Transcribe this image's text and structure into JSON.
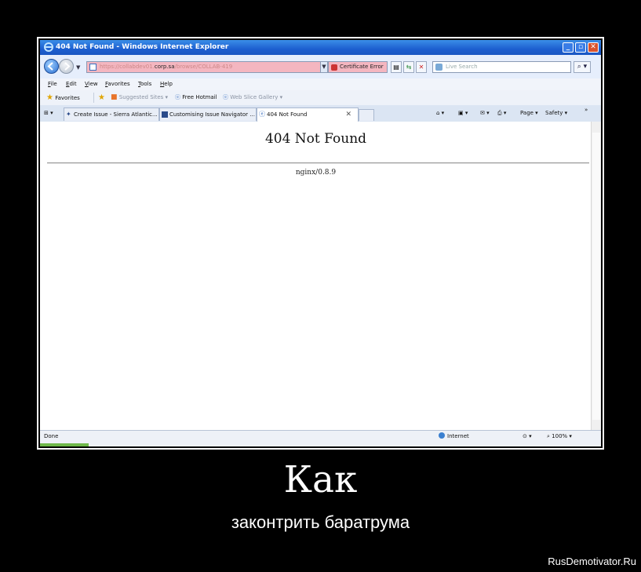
{
  "window": {
    "title": "404 Not Found - Windows Internet Explorer",
    "minimize": "_",
    "maximize": "▫",
    "close": "✕"
  },
  "address": {
    "url_prefix": "https://collabdev01.",
    "url_host": "corp.sa",
    "url_suffix": "/browse/COLLAB-419",
    "cert_error": "Certificate Error",
    "search_placeholder": "Live Search"
  },
  "menu": [
    "File",
    "Edit",
    "View",
    "Favorites",
    "Tools",
    "Help"
  ],
  "favorites_bar": {
    "favorites": "Favorites",
    "suggested_sites": "Suggested Sites ▾",
    "free_hotmail": "Free Hotmail",
    "web_slice_gallery": "Web Slice Gallery ▾"
  },
  "tabs": [
    {
      "label": "Create Issue - Sierra Atlantic..."
    },
    {
      "label": "Customising Issue Navigator ..."
    },
    {
      "label": "404 Not Found"
    }
  ],
  "command_bar": {
    "page": "Page ▾",
    "safety": "Safety ▾",
    "more": "»"
  },
  "page": {
    "heading": "404 Not Found",
    "server": "nginx/0.8.9"
  },
  "status": {
    "left": "Done",
    "zone": "Internet",
    "zoom": "100%"
  },
  "caption": {
    "title": "Как",
    "subtitle": "законтрить баратрума",
    "watermark": "RusDemotivator.Ru"
  }
}
